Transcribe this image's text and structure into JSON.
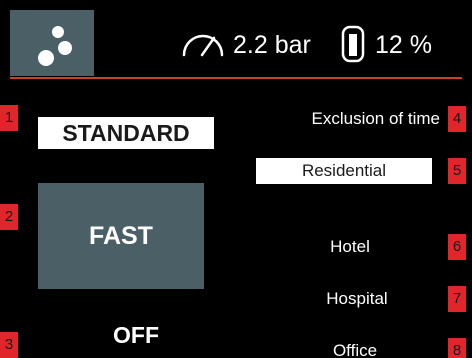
{
  "header": {
    "pressure": "2.2 bar",
    "level": "12 %",
    "icons": {
      "logo": "dots-logo-icon",
      "pressure": "gauge-icon",
      "level": "tank-level-icon"
    }
  },
  "markers": [
    "1",
    "2",
    "3",
    "4",
    "5",
    "6",
    "7",
    "8"
  ],
  "modes": {
    "standard": "STANDARD",
    "fast": "FAST",
    "off": "OFF",
    "selected": "fast"
  },
  "options": {
    "exclusion": "Exclusion of time",
    "residential": "Residential",
    "hotel": "Hotel",
    "hospital": "Hospital",
    "office": "Office",
    "selected": "residential"
  },
  "colors": {
    "background": "#000000",
    "panel": "#4b5f66",
    "accent_line": "#c8412f",
    "marker": "#e0262b",
    "selected_light": "#ffffff"
  }
}
